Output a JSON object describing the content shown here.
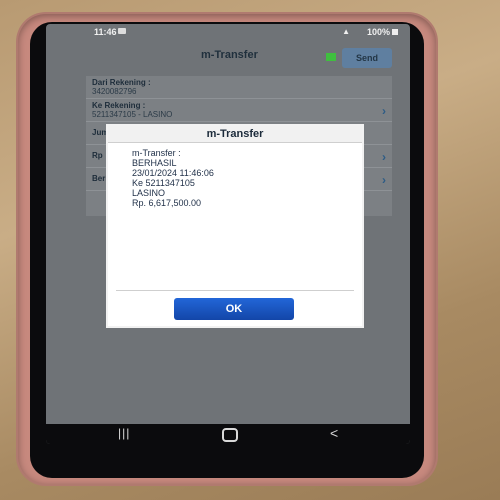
{
  "status_bar": {
    "time": "11:46",
    "battery": "100%"
  },
  "header": {
    "title": "m-Transfer",
    "send_label": "Send"
  },
  "form": {
    "from_label": "Dari Rekening :",
    "from_value": "3420082796",
    "to_label": "Ke Rekening :",
    "to_value": "5211347105 - LASINO",
    "amount_label": "Jum",
    "currency_label": "Rp",
    "news_label": "Berit"
  },
  "dialog": {
    "title": "m-Transfer",
    "lines": [
      "m-Transfer :",
      "BERHASIL",
      "23/01/2024 11:46:06",
      "Ke 5211347105",
      "LASINO",
      "Rp. 6,617,500.00"
    ],
    "ok_label": "OK"
  },
  "nav": {
    "recent": "|||",
    "back": "<"
  },
  "colors": {
    "accent": "#1a55c8",
    "success": "#3fbf3f",
    "screen_dim": "#6f7377"
  }
}
